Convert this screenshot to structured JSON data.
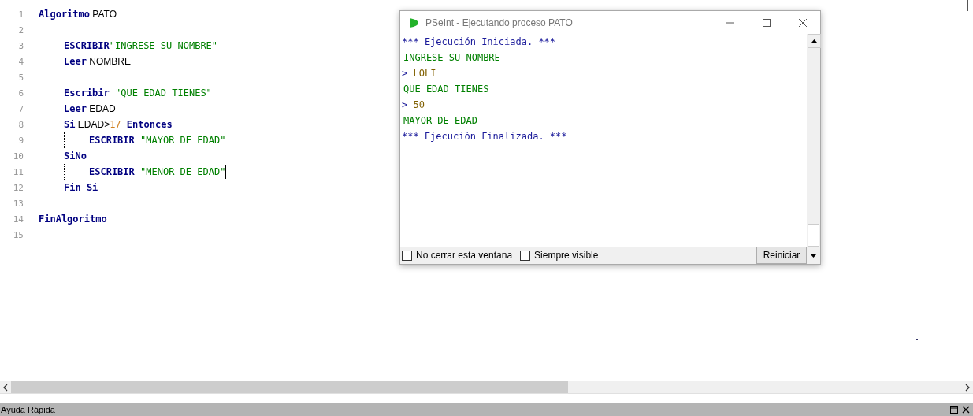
{
  "editor": {
    "lines": [
      {
        "number": "1",
        "guide": false,
        "cursor": false,
        "tokens": [
          {
            "kind": "keyword",
            "text": "Algoritmo"
          },
          {
            "kind": "plain",
            "text": " PATO"
          }
        ],
        "children": [
          {
            "number": "2",
            "guide": false,
            "cursor": false
          },
          {
            "number": "3",
            "guide": false,
            "cursor": false,
            "tokens": [
              {
                "kind": "keyword",
                "text": "ESCRIBIR"
              },
              {
                "kind": "string",
                "text": "\"INGRESE SU NOMBRE\""
              }
            ]
          },
          {
            "number": "4",
            "guide": false,
            "cursor": false,
            "tokens": [
              {
                "kind": "keyword",
                "text": "Leer"
              },
              {
                "kind": "plain",
                "text": " NOMBRE"
              }
            ]
          },
          {
            "number": "5",
            "guide": false,
            "cursor": false
          },
          {
            "number": "6",
            "guide": false,
            "cursor": false,
            "tokens": [
              {
                "kind": "keyword",
                "text": "Escribir"
              },
              {
                "kind": "string",
                "text": " \"QUE EDAD TIENES\""
              }
            ]
          },
          {
            "number": "7",
            "guide": false,
            "cursor": false,
            "tokens": [
              {
                "kind": "keyword",
                "text": "Leer"
              },
              {
                "kind": "plain",
                "text": " EDAD"
              }
            ]
          },
          {
            "number": "8",
            "guide": false,
            "cursor": false,
            "tokens": [
              {
                "kind": "keyword",
                "text": "Si"
              },
              {
                "kind": "plain",
                "text": " EDAD>"
              },
              {
                "kind": "number",
                "text": "17"
              },
              {
                "kind": "keyword",
                "text": " Entonces"
              }
            ],
            "children": [
              {
                "number": "9",
                "guide": true,
                "cursor": false,
                "tokens": [
                  {
                    "kind": "keyword",
                    "text": "ESCRIBIR"
                  },
                  {
                    "kind": "string",
                    "text": " \"MAYOR DE EDAD\""
                  }
                ]
              }
            ]
          },
          {
            "number": "10",
            "guide": false,
            "cursor": false,
            "tokens": [
              {
                "kind": "keyword",
                "text": "SiNo"
              }
            ],
            "children": [
              {
                "number": "11",
                "guide": true,
                "cursor": true,
                "tokens": [
                  {
                    "kind": "keyword",
                    "text": "ESCRIBIR"
                  },
                  {
                    "kind": "string",
                    "text": " \"MENOR DE EDAD\""
                  }
                ]
              }
            ]
          },
          {
            "number": "12",
            "guide": false,
            "cursor": false,
            "tokens": [
              {
                "kind": "keyword",
                "text": "Fin Si"
              }
            ]
          },
          {
            "number": "13",
            "guide": false,
            "cursor": false
          }
        ]
      },
      {
        "number": "14",
        "guide": false,
        "cursor": false,
        "tokens": [
          {
            "kind": "keyword",
            "text": "FinAlgoritmo"
          }
        ]
      },
      {
        "number": "15",
        "guide": false,
        "cursor": false
      }
    ]
  },
  "console_window": {
    "title": "PSeInt - Ejecutando proceso PATO",
    "lines": [
      {
        "kind": "system",
        "text": "*** Ejecución Iniciada. ***"
      },
      {
        "kind": "output",
        "text": "INGRESE SU NOMBRE"
      },
      {
        "kind": "input",
        "prompt": ">",
        "text": "LOLI"
      },
      {
        "kind": "output",
        "text": "QUE EDAD TIENES"
      },
      {
        "kind": "input",
        "prompt": ">",
        "text": "50"
      },
      {
        "kind": "output",
        "text": "MAYOR DE EDAD"
      },
      {
        "kind": "system",
        "text": "*** Ejecución Finalizada. ***"
      }
    ],
    "options": [
      {
        "label": "No cerrar esta ventana",
        "checked": false
      },
      {
        "label": "Siempre visible",
        "checked": false
      }
    ],
    "button": "Reiniciar"
  },
  "help_panel": {
    "title": "Ayuda Rápida"
  }
}
